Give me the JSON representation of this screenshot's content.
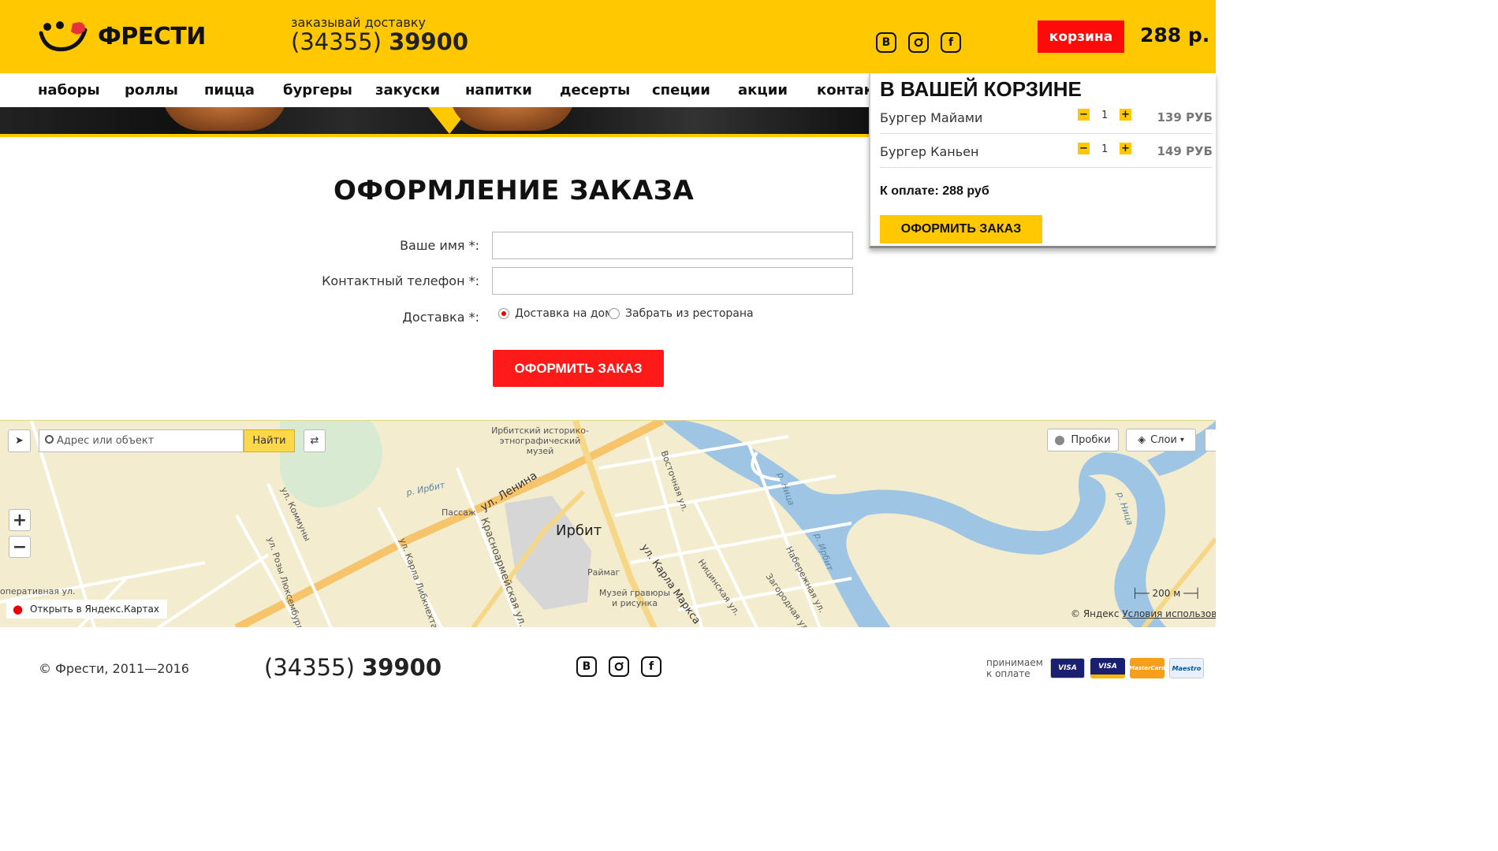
{
  "header": {
    "logo_text": "ФРЕСТИ",
    "delivery_caption": "заказывай доставку",
    "phone_code": "(34355)",
    "phone_number": "39900",
    "social": [
      "В",
      "ig",
      "f"
    ],
    "cart_label": "корзина",
    "cart_total": "288 р."
  },
  "nav": {
    "items": [
      "наборы",
      "роллы",
      "пицца",
      "бургеры",
      "закуски",
      "напитки",
      "десерты",
      "специи",
      "акции",
      "контакт"
    ]
  },
  "cart_panel": {
    "title": "В ВАШЕЙ КОРЗИНЕ",
    "items": [
      {
        "name": "Бургер Майами",
        "qty": "1",
        "price": "139 РУБ"
      },
      {
        "name": "Бургер Каньен",
        "qty": "1",
        "price": "149 РУБ"
      }
    ],
    "total": "К оплате: 288 руб",
    "order_button": "ОФОРМИТЬ ЗАКАЗ"
  },
  "form": {
    "title": "ОФОРМЛЕНИЕ ЗАКАЗА",
    "name_label": "Ваше имя *:",
    "phone_label": "Контактный телефон *:",
    "delivery_label": "Доставка *:",
    "option_home": "Доставка на дом",
    "option_pickup": "Забрать из ресторана",
    "selected_option": "Доставка на дом",
    "submit": "ОФОРМИТЬ ЗАКАЗ"
  },
  "map": {
    "search_placeholder": "Адрес или объект",
    "find_button": "Найти",
    "traffic_button": "Пробки",
    "layers_button": "Слои",
    "zoom_in": "+",
    "zoom_out": "−",
    "city": "Ирбит",
    "labels": {
      "museum": "Ирбитский историко-этнографический музей",
      "lenina": "ул. Ленина",
      "passage": "Пассаж",
      "kommuny": "ул. Коммуны",
      "rozy": "ул. Розы Люксембург",
      "libknekhta": "ул. Карла Либкнехта",
      "krasnoarm": "Красноармейская ул.",
      "raymag": "Раймаг",
      "marksa": "ул. Карла Маркса",
      "engraving": "Музей гравюры и рисунка",
      "vostochnaya": "Восточная ул.",
      "nitsinskaya": "Ницинская ул.",
      "zagorodnaya": "Загородная ул.",
      "naberezhnaya": "Набережная ул.",
      "kooperativnaya": "оперативная ул."
    },
    "rivers": {
      "irbit1": "р. Ирбит",
      "nitsa1": "р. Ница",
      "irbit2": "р. Ирбит",
      "nitsa2": "р. Ница"
    },
    "open_link": "Открыть в Яндекс.Картах",
    "copyright": "© Яндекс",
    "terms": "Условия использования",
    "scale": "200 м"
  },
  "footer": {
    "copyright": "© Фрести, 2011—2016",
    "phone_code": "(34355)",
    "phone_number": "39900",
    "pay_caption_1": "принимаем",
    "pay_caption_2": "к оплате",
    "cards": [
      "VISA",
      "VISA",
      "MasterCard",
      "Maestro"
    ]
  },
  "colors": {
    "brand_yellow": "#ffc800",
    "accent_red": "#ff1a1a"
  }
}
